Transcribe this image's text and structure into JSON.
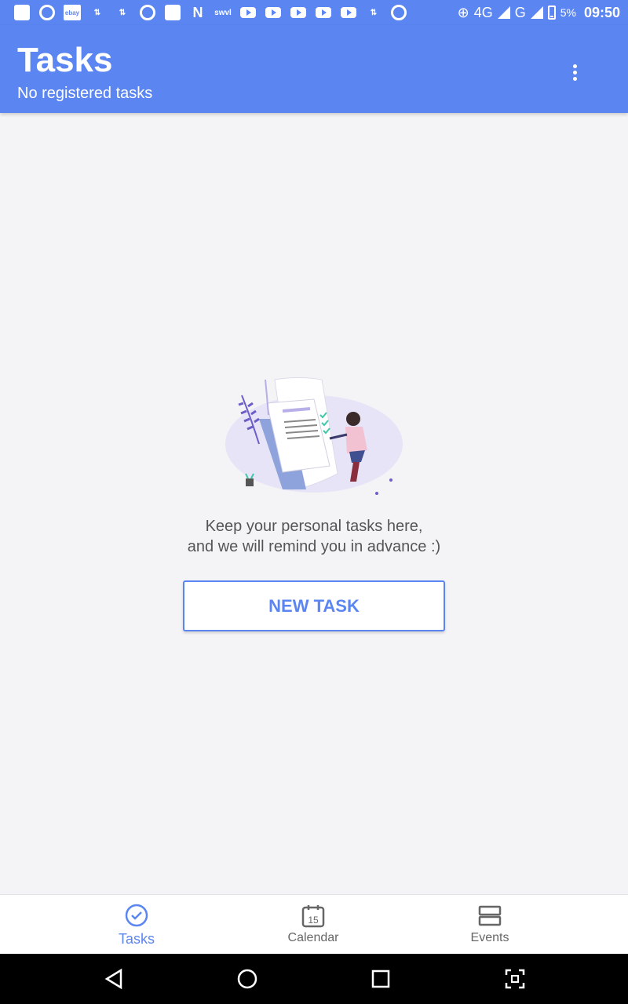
{
  "status_bar": {
    "network_label": "4G",
    "network2_label": "G",
    "small_label": "swvl",
    "battery_percent": "5%",
    "time": "09:50"
  },
  "app_bar": {
    "title": "Tasks",
    "subtitle": "No registered tasks"
  },
  "empty_state": {
    "line1": "Keep your personal tasks here,",
    "line2": "and we will remind you in advance :)",
    "button_label": "NEW TASK"
  },
  "bottom_nav": {
    "items": [
      {
        "label": "Tasks",
        "icon": "check-circle-icon",
        "active": true
      },
      {
        "label": "Calendar",
        "icon": "calendar-icon",
        "active": false,
        "icon_text": "15"
      },
      {
        "label": "Events",
        "icon": "events-icon",
        "active": false
      }
    ]
  },
  "colors": {
    "primary": "#5b86f2",
    "background": "#f4f4f6"
  }
}
